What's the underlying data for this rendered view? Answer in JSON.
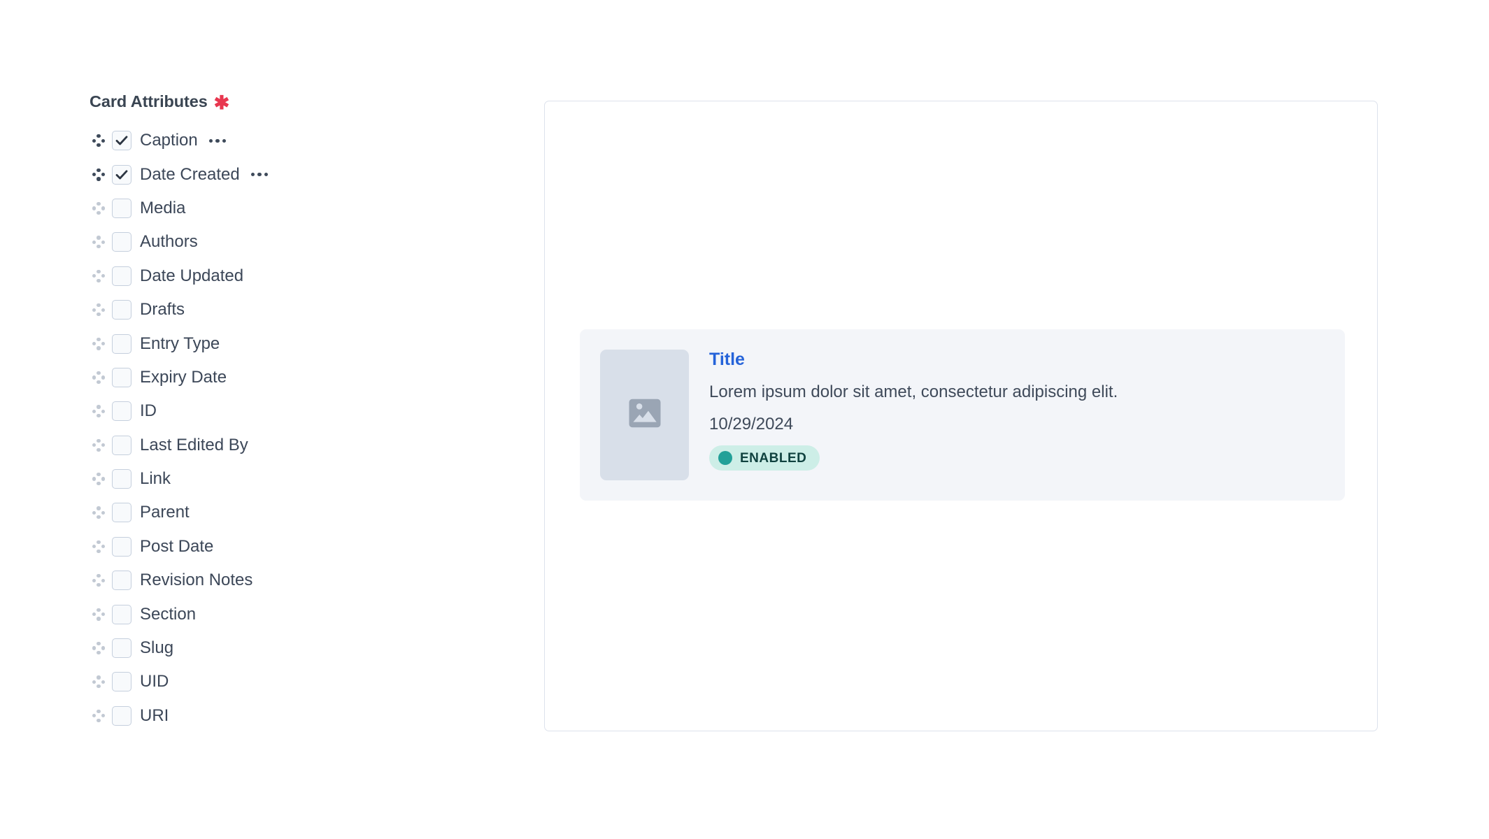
{
  "attributes": {
    "title": "Card Attributes",
    "required_marker": "✱",
    "items": [
      {
        "label": "Caption",
        "checked": true,
        "menu_icon": "ellipsis-icon",
        "handle_icon": "drag-handle-icon"
      },
      {
        "label": "Date Created",
        "checked": true,
        "menu_icon": "ellipsis-icon",
        "handle_icon": "drag-handle-icon"
      },
      {
        "label": "Media",
        "checked": false,
        "menu_icon": "ellipsis-icon",
        "handle_icon": "drag-handle-icon"
      },
      {
        "label": "Authors",
        "checked": false,
        "menu_icon": "ellipsis-icon",
        "handle_icon": "drag-handle-icon"
      },
      {
        "label": "Date Updated",
        "checked": false,
        "menu_icon": "ellipsis-icon",
        "handle_icon": "drag-handle-icon"
      },
      {
        "label": "Drafts",
        "checked": false,
        "menu_icon": "ellipsis-icon",
        "handle_icon": "drag-handle-icon"
      },
      {
        "label": "Entry Type",
        "checked": false,
        "menu_icon": "ellipsis-icon",
        "handle_icon": "drag-handle-icon"
      },
      {
        "label": "Expiry Date",
        "checked": false,
        "menu_icon": "ellipsis-icon",
        "handle_icon": "drag-handle-icon"
      },
      {
        "label": "ID",
        "checked": false,
        "menu_icon": "ellipsis-icon",
        "handle_icon": "drag-handle-icon"
      },
      {
        "label": "Last Edited By",
        "checked": false,
        "menu_icon": "ellipsis-icon",
        "handle_icon": "drag-handle-icon"
      },
      {
        "label": "Link",
        "checked": false,
        "menu_icon": "ellipsis-icon",
        "handle_icon": "drag-handle-icon"
      },
      {
        "label": "Parent",
        "checked": false,
        "menu_icon": "ellipsis-icon",
        "handle_icon": "drag-handle-icon"
      },
      {
        "label": "Post Date",
        "checked": false,
        "menu_icon": "ellipsis-icon",
        "handle_icon": "drag-handle-icon"
      },
      {
        "label": "Revision Notes",
        "checked": false,
        "menu_icon": "ellipsis-icon",
        "handle_icon": "drag-handle-icon"
      },
      {
        "label": "Section",
        "checked": false,
        "menu_icon": "ellipsis-icon",
        "handle_icon": "drag-handle-icon"
      },
      {
        "label": "Slug",
        "checked": false,
        "menu_icon": "ellipsis-icon",
        "handle_icon": "drag-handle-icon"
      },
      {
        "label": "UID",
        "checked": false,
        "menu_icon": "ellipsis-icon",
        "handle_icon": "drag-handle-icon"
      },
      {
        "label": "URI",
        "checked": false,
        "menu_icon": "ellipsis-icon",
        "handle_icon": "drag-handle-icon"
      }
    ]
  },
  "preview": {
    "card": {
      "thumbnail_icon": "image-placeholder-icon",
      "title": "Title",
      "description": "Lorem ipsum dolor sit amet, consectetur adipiscing elit.",
      "date": "10/29/2024",
      "status_label": "ENABLED",
      "status_dot_icon": "status-dot-icon"
    }
  },
  "colors": {
    "required_asterisk": "#e8374f",
    "heading_text": "#3a4552",
    "label_text": "#3c4758",
    "checkbox_border": "#c5cfdd",
    "checkbox_fill": "#f8fafc",
    "handle_active": "#3e4a5a",
    "handle_inactive": "#c2c9d3",
    "panel_border": "#dde2ec",
    "card_background": "#f3f5f9",
    "thumbnail_background": "#d8dfe9",
    "thumbnail_icon": "#9aa5b4",
    "card_title": "#2563d9",
    "card_text": "#3f4a5a",
    "badge_background": "#cdeee7",
    "badge_dot": "#22a098",
    "badge_text": "#10423f"
  }
}
